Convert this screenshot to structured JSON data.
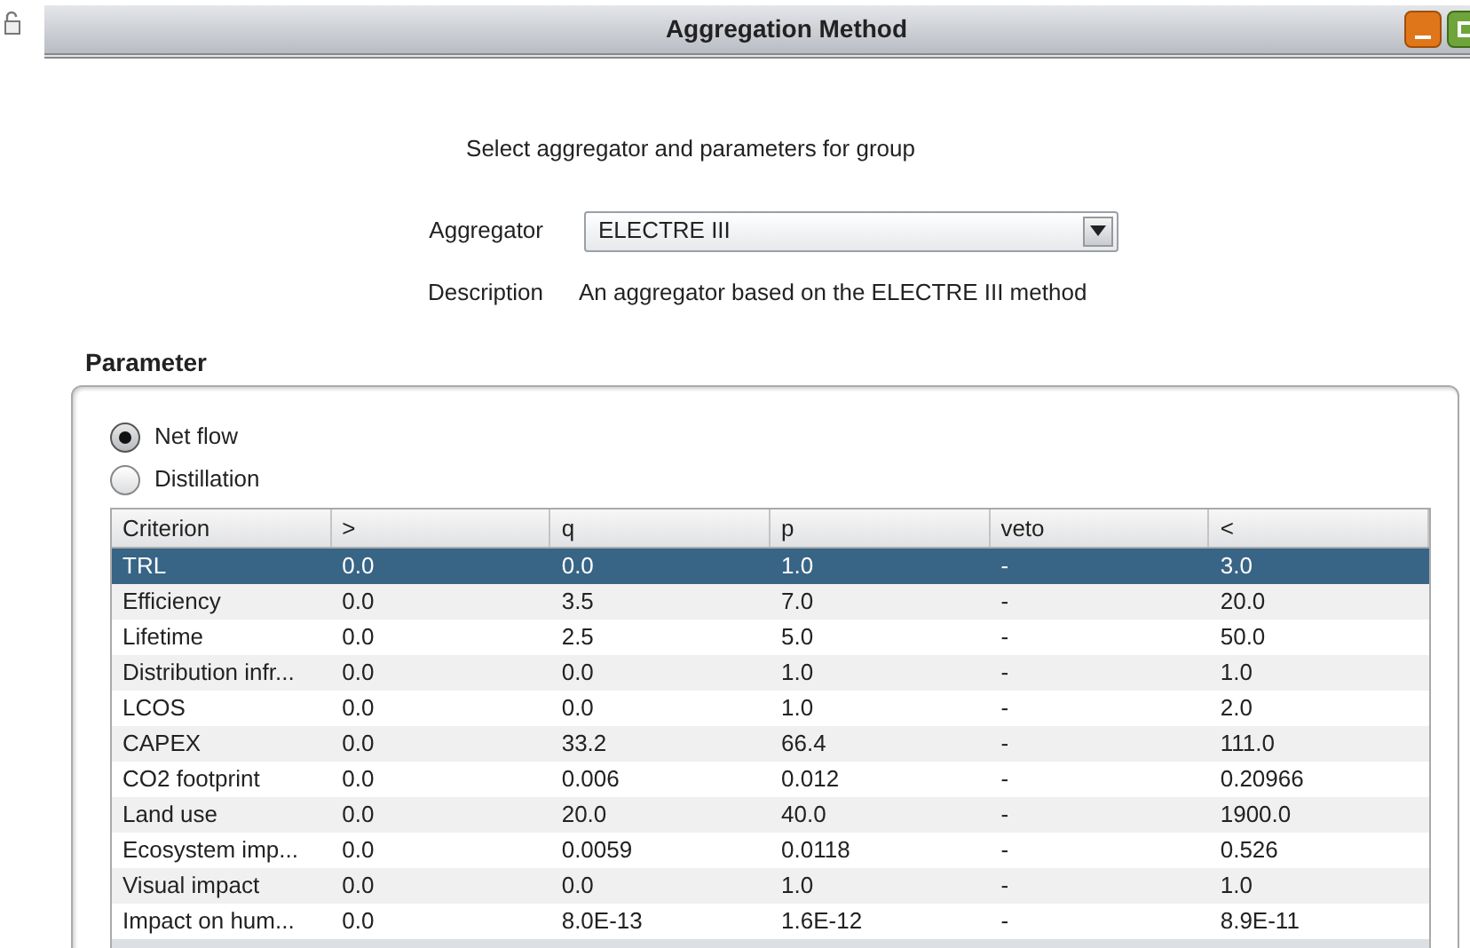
{
  "window": {
    "title": "Aggregation Method"
  },
  "prompt": "Select aggregator and parameters for group",
  "aggregator": {
    "label": "Aggregator",
    "value": "ELECTRE III"
  },
  "description": {
    "label": "Description",
    "value": "An aggregator based on the ELECTRE III method"
  },
  "parameter": {
    "title": "Parameter",
    "options": [
      {
        "label": "Net flow",
        "selected": true
      },
      {
        "label": "Distillation",
        "selected": false
      }
    ],
    "table": {
      "columns": [
        "Criterion",
        ">",
        "q",
        "p",
        "veto",
        "<"
      ],
      "rows": [
        {
          "cells": [
            "TRL",
            "0.0",
            "0.0",
            "1.0",
            "-",
            "3.0"
          ],
          "selected": true
        },
        {
          "cells": [
            "Efficiency",
            "0.0",
            "3.5",
            "7.0",
            "-",
            "20.0"
          ],
          "selected": false
        },
        {
          "cells": [
            "Lifetime",
            "0.0",
            "2.5",
            "5.0",
            "-",
            "50.0"
          ],
          "selected": false
        },
        {
          "cells": [
            "Distribution infr...",
            "0.0",
            "0.0",
            "1.0",
            "-",
            "1.0"
          ],
          "selected": false
        },
        {
          "cells": [
            "LCOS",
            "0.0",
            "0.0",
            "1.0",
            "-",
            "2.0"
          ],
          "selected": false
        },
        {
          "cells": [
            "CAPEX",
            "0.0",
            "33.2",
            "66.4",
            "-",
            "111.0"
          ],
          "selected": false
        },
        {
          "cells": [
            "CO2 footprint",
            "0.0",
            "0.006",
            "0.012",
            "-",
            "0.20966"
          ],
          "selected": false
        },
        {
          "cells": [
            "Land use",
            "0.0",
            "20.0",
            "40.0",
            "-",
            "1900.0"
          ],
          "selected": false
        },
        {
          "cells": [
            "Ecosystem imp...",
            "0.0",
            "0.0059",
            "0.0118",
            "-",
            "0.526"
          ],
          "selected": false
        },
        {
          "cells": [
            "Visual impact",
            "0.0",
            "0.0",
            "1.0",
            "-",
            "1.0"
          ],
          "selected": false
        },
        {
          "cells": [
            "Impact on hum...",
            "0.0",
            "8.0E-13",
            "1.6E-12",
            "-",
            "8.9E-11"
          ],
          "selected": false
        }
      ]
    }
  }
}
